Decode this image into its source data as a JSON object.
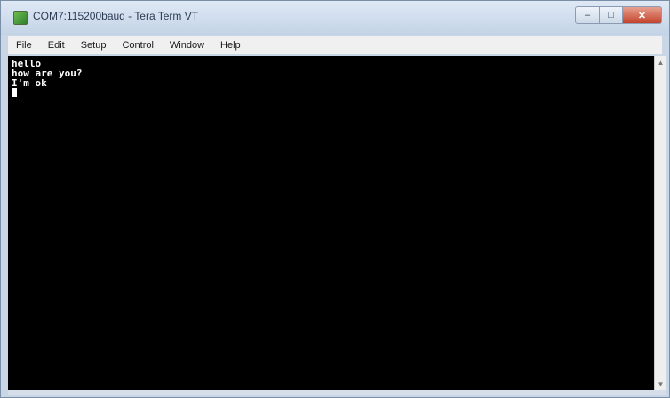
{
  "window": {
    "title": "COM7:115200baud - Tera Term VT",
    "icon": "tera-term-icon",
    "minimize_glyph": "–",
    "maximize_glyph": "□",
    "close_glyph": "✕"
  },
  "menu": {
    "items": [
      {
        "label": "File"
      },
      {
        "label": "Edit"
      },
      {
        "label": "Setup"
      },
      {
        "label": "Control"
      },
      {
        "label": "Window"
      },
      {
        "label": "Help"
      }
    ]
  },
  "terminal": {
    "lines": [
      "hello",
      "how are you?",
      "I'm ok"
    ]
  },
  "scrollbar": {
    "up_glyph": "▲",
    "down_glyph": "▼"
  }
}
